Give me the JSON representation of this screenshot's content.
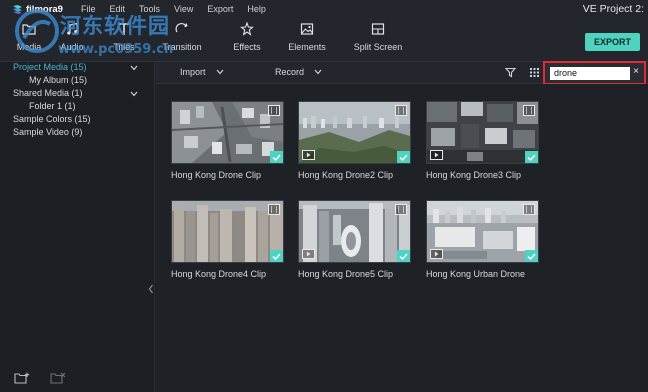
{
  "app": {
    "name": "filmora9",
    "project_title": "VE Project 2:"
  },
  "menu": [
    "File",
    "Edit",
    "Tools",
    "View",
    "Export",
    "Help"
  ],
  "watermark": {
    "text": "河东软件园",
    "url": "www.pc0359.cn"
  },
  "toolbar": {
    "tools": [
      {
        "label": "Media",
        "icon": "folder-icon"
      },
      {
        "label": "Audio",
        "icon": "music-note-icon"
      },
      {
        "label": "Titles",
        "icon": "text-t-icon"
      },
      {
        "label": "Transition",
        "icon": "transition-icon"
      },
      {
        "label": "Effects",
        "icon": "effects-icon"
      },
      {
        "label": "Elements",
        "icon": "image-icon"
      },
      {
        "label": "Split Screen",
        "icon": "split-screen-icon"
      }
    ],
    "export_label": "EXPORT",
    "accent": "#4ed3c0"
  },
  "sidebar": {
    "items": [
      {
        "label": "Project Media (15)",
        "active": true,
        "expandable": true
      },
      {
        "label": "My Album (15)"
      },
      {
        "label": "Shared Media (1)",
        "expandable": true
      },
      {
        "label": "Folder 1 (1)"
      },
      {
        "label": "Sample Colors (15)"
      },
      {
        "label": "Sample Video (9)"
      }
    ],
    "active_color": "#4fb3c7"
  },
  "content_header": {
    "import_label": "Import",
    "record_label": "Record",
    "search_value": "drone",
    "search_clear": "×",
    "highlight_color": "#e12a33"
  },
  "clips": [
    {
      "label": "Hong Kong Drone Clip",
      "has_audio_badge": false
    },
    {
      "label": "Hong Kong Drone2 Clip",
      "has_audio_badge": true
    },
    {
      "label": "Hong Kong Drone3 Clip",
      "has_audio_badge": true
    },
    {
      "label": "Hong Kong Drone4 Clip",
      "has_audio_badge": false
    },
    {
      "label": "Hong Kong Drone5 Clip",
      "has_audio_badge": true
    },
    {
      "label": "Hong Kong Urban Drone",
      "has_audio_badge": true
    }
  ]
}
